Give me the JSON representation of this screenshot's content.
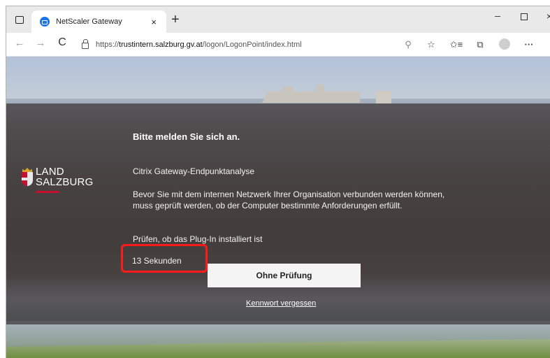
{
  "browser": {
    "tab": {
      "title": "NetScaler Gateway",
      "close": "×"
    },
    "new_tab": "+",
    "window_controls": {
      "minimize": "–",
      "close": "×"
    },
    "nav": {
      "back": "←",
      "forward": "→",
      "reload": "C"
    },
    "url": {
      "scheme": "https://",
      "host": "trustintern.salzburg.gv.at",
      "path": "/logon/LogonPoint/index.html"
    },
    "icons": {
      "tab_actions": "tab-actions-icon",
      "key": "key-icon",
      "favorites": "add-favorite-icon",
      "favorites_bar": "favorites-icon",
      "collections": "collections-icon",
      "profile": "profile-icon",
      "more": "more-icon"
    },
    "glyphs": {
      "key": "⚲",
      "favorite": "☆",
      "favorites": "✩≡",
      "collections": "⧉",
      "more": "···"
    }
  },
  "logo": {
    "line1": "LAND",
    "line2": "SALZBURG",
    "accent_color": "#c8102e"
  },
  "login": {
    "heading": "Bitte melden Sie sich an.",
    "subheading": "Citrix Gateway-Endpunktanalyse",
    "description": "Bevor Sie mit dem internen Netzwerk Ihrer Organisation verbunden werden können, muss geprüft werden, ob der Computer bestimmte Anforderungen erfüllt.",
    "check_text": "Prüfen, ob das Plug-In installiert ist",
    "countdown": "13 Sekunden",
    "skip_button": "Ohne Prüfung",
    "forgot_link": "Kennwort vergessen",
    "highlight_color": "#ff1a1a"
  }
}
